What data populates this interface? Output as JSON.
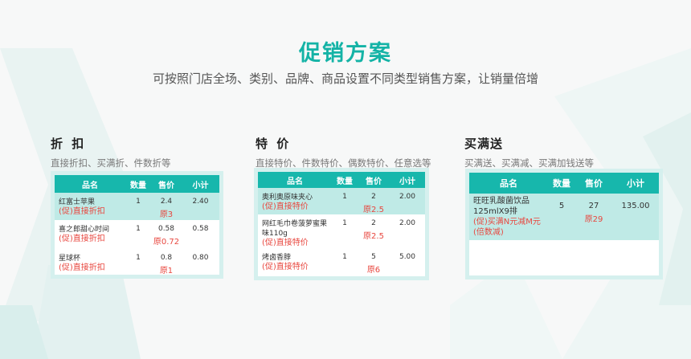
{
  "header": {
    "title": "促销方案",
    "subtitle": "可按照门店全场、类别、品牌、商品设置不同类型销售方案，让销量倍增"
  },
  "columns": {
    "name": "品名",
    "qty": "数量",
    "price": "售价",
    "subtotal": "小计"
  },
  "sections": [
    {
      "title": "折 扣",
      "subtitle": "直接折扣、买满折、件数折等",
      "rows": [
        {
          "name": "红富士苹果",
          "promo": "(促)直接折扣",
          "qty": "1",
          "price": "2.4",
          "orig": "原3",
          "subtotal": "2.40"
        },
        {
          "name": "喜之郎甜心时间",
          "promo": "(促)直接折扣",
          "qty": "1",
          "price": "0.58",
          "orig": "原0.72",
          "subtotal": "0.58"
        },
        {
          "name": "星球杯",
          "promo": "(促)直接折扣",
          "qty": "1",
          "price": "0.8",
          "orig": "原1",
          "subtotal": "0.80"
        }
      ]
    },
    {
      "title": "特 价",
      "subtitle": "直接特价、件数特价、偶数特价、任意选等",
      "rows": [
        {
          "name": "奥利奥原味夹心",
          "promo": "(促)直接特价",
          "qty": "1",
          "price": "2",
          "orig": "原2.5",
          "subtotal": "2.00"
        },
        {
          "name": "网红毛巾卷菠萝蜜果味110g",
          "promo": "(促)直接特价",
          "qty": "1",
          "price": "2",
          "orig": "原2.5",
          "subtotal": "2.00"
        },
        {
          "name": "烤卤香脖",
          "promo": "(促)直接特价",
          "qty": "1",
          "price": "5",
          "orig": "原6",
          "subtotal": "5.00"
        }
      ]
    },
    {
      "title": "买满送",
      "subtitle": "买满送、买满减、买满加钱送等",
      "rows": [
        {
          "name": "旺旺乳酸菌饮品125mlX9排",
          "promo": "(促)买满N元减M元(倍数减)",
          "qty": "5",
          "price": "27",
          "orig": "原29",
          "subtotal": "135.00"
        }
      ]
    }
  ]
}
